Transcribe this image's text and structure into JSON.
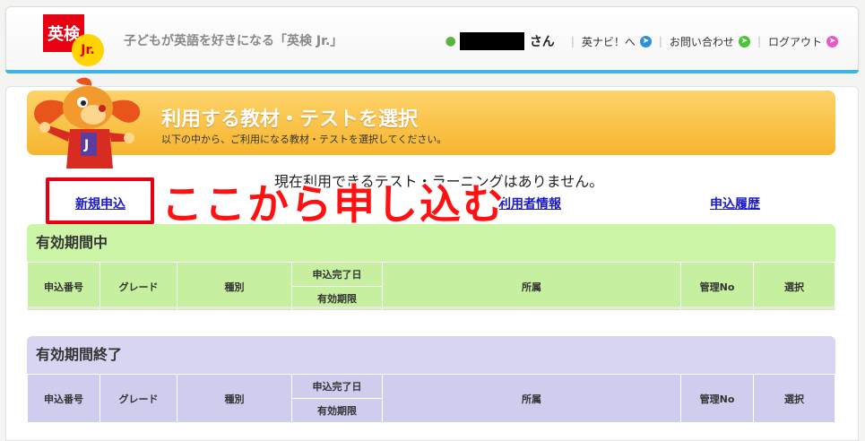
{
  "header": {
    "logo_top": "英検",
    "logo_bottom": "Jr.",
    "tagline": "子どもが英語を好きになる「英検 Jr.」",
    "user_suffix": "さん",
    "nav": [
      {
        "label": "英ナビ！へ",
        "color": "#2e8fd8"
      },
      {
        "label": "お問い合わせ",
        "color": "#4dc23a"
      },
      {
        "label": "ログアウト",
        "color": "#e65ac8"
      }
    ]
  },
  "banner": {
    "title": "利用する教材・テストを選択",
    "subtitle": "以下の中から、ご利用になる教材・テストを選択してください。"
  },
  "notice": "現在利用できるテスト・ラーニングはありません。",
  "links": {
    "new_application": "新規申込",
    "user_info": "利用者情報",
    "history": "申込履歴"
  },
  "annotation": "ここから申し込む",
  "tables": [
    {
      "title": "有効期間中",
      "columns": [
        "申込番号",
        "グレード",
        "種別",
        "申込完了日",
        "有効期限",
        "所属",
        "管理No",
        "選択"
      ],
      "color": "#c6f09f"
    },
    {
      "title": "有効期間終了",
      "columns": [
        "申込番号",
        "グレード",
        "種別",
        "申込完了日",
        "有効期限",
        "所属",
        "管理No",
        "選択"
      ],
      "color": "#cfcdee"
    }
  ],
  "colors": {
    "accent": "#3cb4e6",
    "banner": "#f6b52e",
    "annotation": "#ff1111"
  }
}
